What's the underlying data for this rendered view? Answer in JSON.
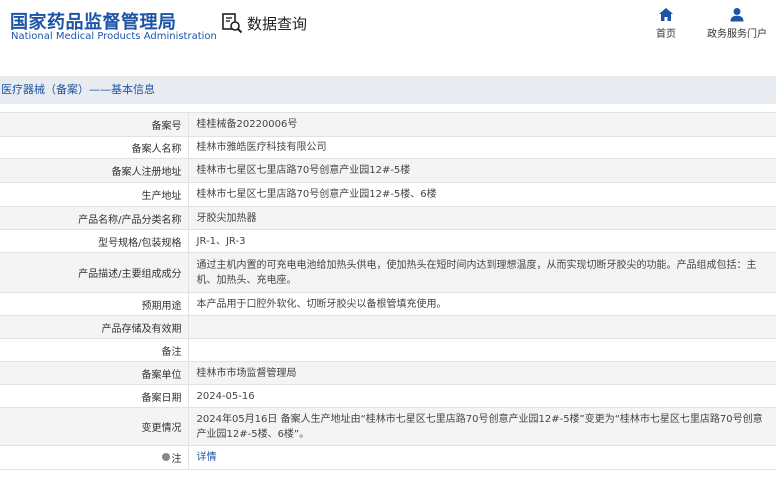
{
  "header": {
    "logo_cn": "国家药品监督管理局",
    "logo_en": "National Medical Products Administration",
    "search_title": "数据查询",
    "nav": {
      "home": "首页",
      "dept": "政务服务门户"
    }
  },
  "breadcrumb": "医疗器械（备案）——基本信息",
  "rows": [
    {
      "label": "备案号",
      "value": "桂桂械备20220006号"
    },
    {
      "label": "备案人名称",
      "value": "桂林市雅皓医疗科技有限公司"
    },
    {
      "label": "备案人注册地址",
      "value": "桂林市七星区七里店路70号创意产业园12#-5楼"
    },
    {
      "label": "生产地址",
      "value": "桂林市七星区七里店路70号创意产业园12#-5楼、6楼"
    },
    {
      "label": "产品名称/产品分类名称",
      "value": "牙胶尖加热器"
    },
    {
      "label": "型号规格/包装规格",
      "value": "JR-1、JR-3"
    },
    {
      "label": "产品描述/主要组成成分",
      "value": "通过主机内置的可充电电池给加热头供电，使加热头在短时间内达到理想温度，从而实现切断牙胶尖的功能。产品组成包括：主机、加热头、充电座。"
    },
    {
      "label": "预期用途",
      "value": "本产品用于口腔外软化、切断牙胶尖以备根管填充使用。"
    },
    {
      "label": "产品存储及有效期",
      "value": ""
    },
    {
      "label": "备注",
      "value": ""
    },
    {
      "label": "备案单位",
      "value": "桂林市市场监督管理局"
    },
    {
      "label": "备案日期",
      "value": "2024-05-16"
    },
    {
      "label": "变更情况",
      "value": "2024年05月16日 备案人生产地址由“桂林市七星区七里店路70号创意产业园12#-5楼”变更为“桂林市七星区七里店路70号创意产业园12#-5楼、6楼”。"
    },
    {
      "label": "注",
      "value": "详情"
    }
  ],
  "colors": {
    "brand_blue": "#1e54a7",
    "breadcrumb_bg": "#e8ebef",
    "row_alt_bg": "#f4f4f4"
  },
  "icons": {
    "search_title": "document-search-icon",
    "home": "home-icon",
    "dept": "user-icon",
    "note": "location-pin-icon"
  }
}
